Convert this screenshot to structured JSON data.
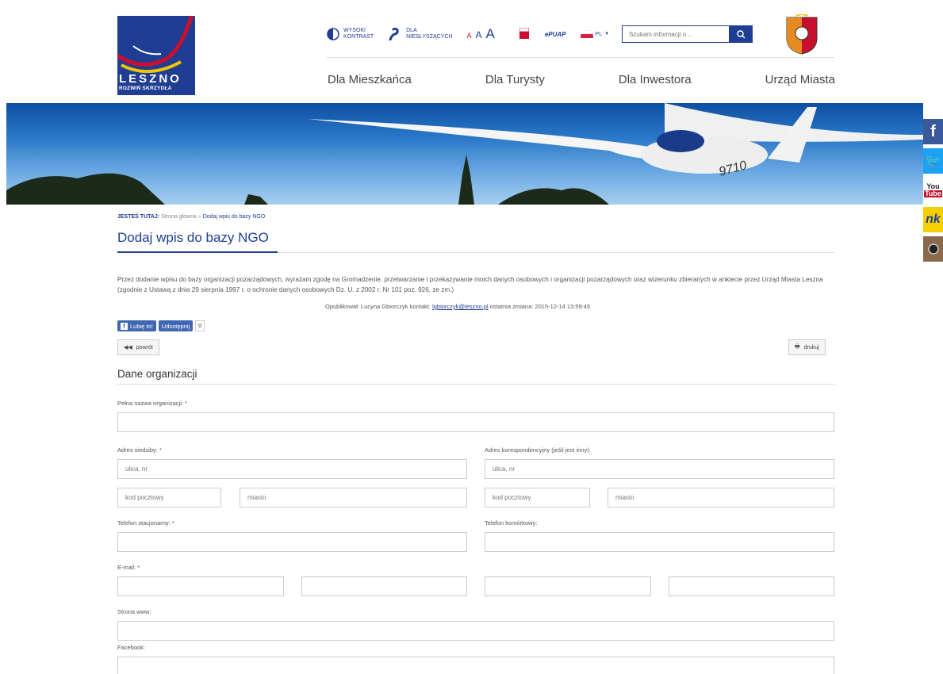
{
  "logo": {
    "name": "LESZNO",
    "tagline": "ROZWIŃ SKRZYDŁA"
  },
  "toolbar": {
    "contrast_label_1": "WYSOKI",
    "contrast_label_2": "KONTRAST",
    "disabled_label_1": "DLA",
    "disabled_label_2": "NIESŁYSZĄCYCH",
    "font_sizes": [
      "A",
      "A",
      "A"
    ],
    "epuap": "ePUAP",
    "lang": "PL",
    "search_placeholder": "Szukam informacji o..."
  },
  "nav": [
    "Dla Mieszkańca",
    "Dla Turysty",
    "Dla Inwestora",
    "Urząd Miasta"
  ],
  "breadcrumb": {
    "label": "JESTEŚ TUTAJ:",
    "home": "Strona główna",
    "sep": "»",
    "current": "Dodaj wpis do bazy NGO"
  },
  "page_title": "Dodaj wpis do bazy NGO",
  "intro": "Przez dodanie wpisu do bazy organizacji pozarządowych, wyrażam zgodę na Gromadzenie, przetwarzanie i przekazywanie moich danych osobowych i organizacji pozarządowych oraz wizerunku zbieranych w ankiecie przez Urząd Miasta Leszna (zgodnie z Ustawą z dnia 29 sierpnia 1997 r. o ochronie danych osobowych Dz. U. z 2002 r. Nr 101 poz. 926, ze zm.)",
  "published": {
    "prefix": "Opublikował: Lucyna Gbiorczyk kontakt:",
    "email": "lgbiorczyk@leszno.pl",
    "suffix": "ostatnia zmiana: 2015-12-14 13:59:45"
  },
  "facebook": {
    "like": "Lubię to!",
    "share": "Udostępnij",
    "count": "0"
  },
  "buttons": {
    "back": "powrót",
    "print": "drukuj"
  },
  "section_title": "Dane organizacji",
  "form": {
    "full_name_label": "Pełna nazwa organizacji: *",
    "seat_address_label": "Adres siedziby: *",
    "corr_address_label": "Adres korespondencyjny (jeśli jest inny):",
    "street_placeholder": "ulica, nr",
    "postcode_placeholder": "kod pocztowy",
    "city_placeholder": "miasto",
    "landline_label": "Telefon stacjonarny: *",
    "mobile_label": "Telefon komórkowy:",
    "email_label": "E-mail: *",
    "www_label": "Strona www:",
    "facebook_label": "Facebook:"
  },
  "social": [
    "f",
    "t",
    "You",
    "nk",
    "ig"
  ],
  "colors": {
    "brand": "#1f3e93",
    "accent_red": "#c8102e"
  }
}
